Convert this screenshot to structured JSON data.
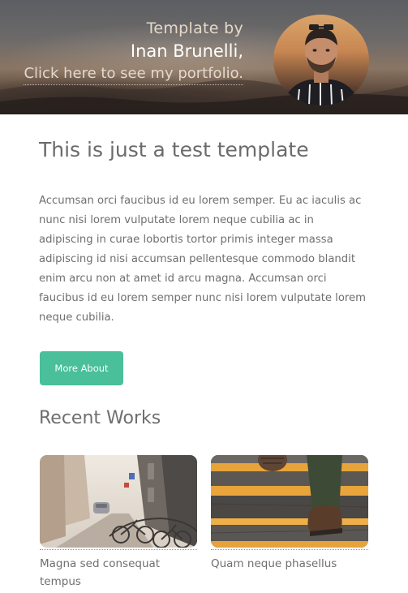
{
  "header": {
    "template_by": "Template by",
    "author_name": "Inan Brunelli,",
    "portfolio_link": "Click here to see my portfolio."
  },
  "main": {
    "title": "This is just a test template",
    "body": "Accumsan orci faucibus id eu lorem semper. Eu ac iaculis ac nunc nisi lorem vulputate lorem neque cubilia ac in adipiscing in curae lobortis tortor primis integer massa adipiscing id nisi accumsan pellentesque commodo blandit enim arcu non at amet id arcu magna. Accumsan orci faucibus id eu lorem semper nunc nisi lorem vulputate lorem neque cubilia.",
    "more_button": "More About"
  },
  "recent": {
    "title": "Recent Works",
    "items": [
      {
        "caption": "Magna sed consequat tempus"
      },
      {
        "caption": "Quam neque phasellus"
      }
    ]
  },
  "colors": {
    "accent": "#49bf9a",
    "text": "#6f6f6f"
  }
}
